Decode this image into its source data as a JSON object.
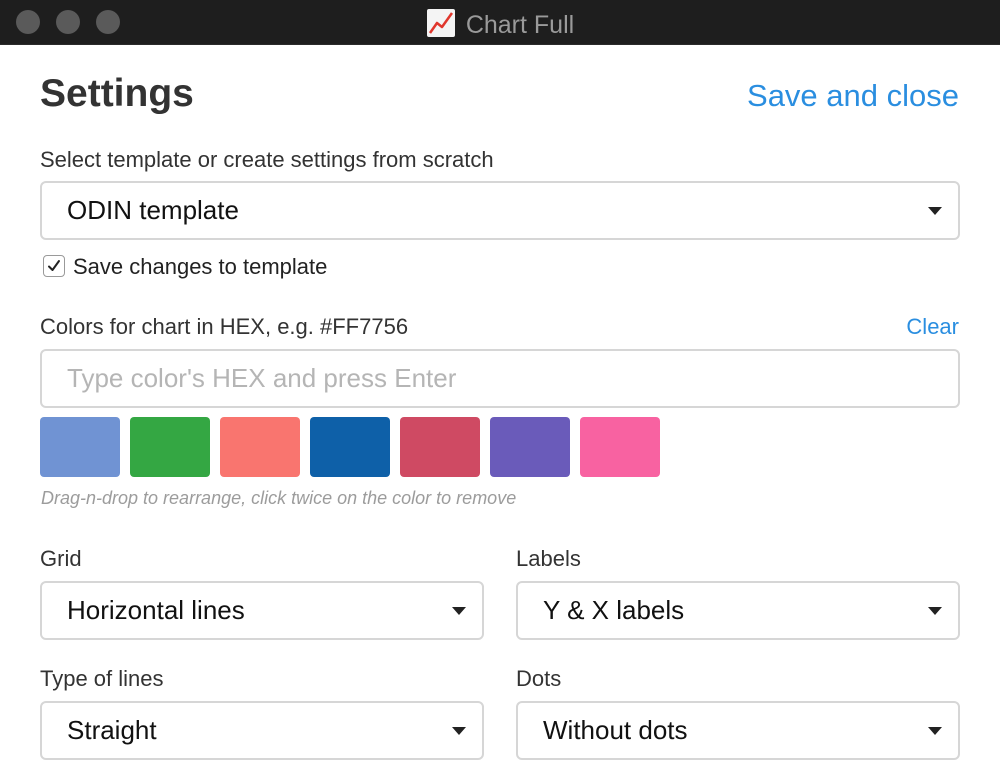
{
  "window": {
    "title": "Chart Full",
    "app_icon": "chart-line-icon"
  },
  "header": {
    "title": "Settings",
    "save_close_label": "Save and close"
  },
  "template": {
    "label": "Select template or create settings from scratch",
    "selected": "ODIN template",
    "save_changes_label": "Save changes to template",
    "save_changes_checked": true
  },
  "colors": {
    "label": "Colors for chart in HEX, e.g. #FF7756",
    "clear_label": "Clear",
    "input_placeholder": "Type color's HEX and press Enter",
    "input_value": "",
    "swatches": [
      "#7093d3",
      "#34a743",
      "#f9756f",
      "#0e60a8",
      "#cf4a63",
      "#6a5bba",
      "#f862a1"
    ],
    "hint": "Drag-n-drop to rearrange, click twice on the color to remove"
  },
  "grid": {
    "label": "Grid",
    "selected": "Horizontal lines"
  },
  "labels": {
    "label": "Labels",
    "selected": "Y & X labels"
  },
  "line_type": {
    "label": "Type of lines",
    "selected": "Straight"
  },
  "dots": {
    "label": "Dots",
    "selected": "Without dots"
  },
  "theme": {
    "link_color": "#2a8ee0"
  }
}
